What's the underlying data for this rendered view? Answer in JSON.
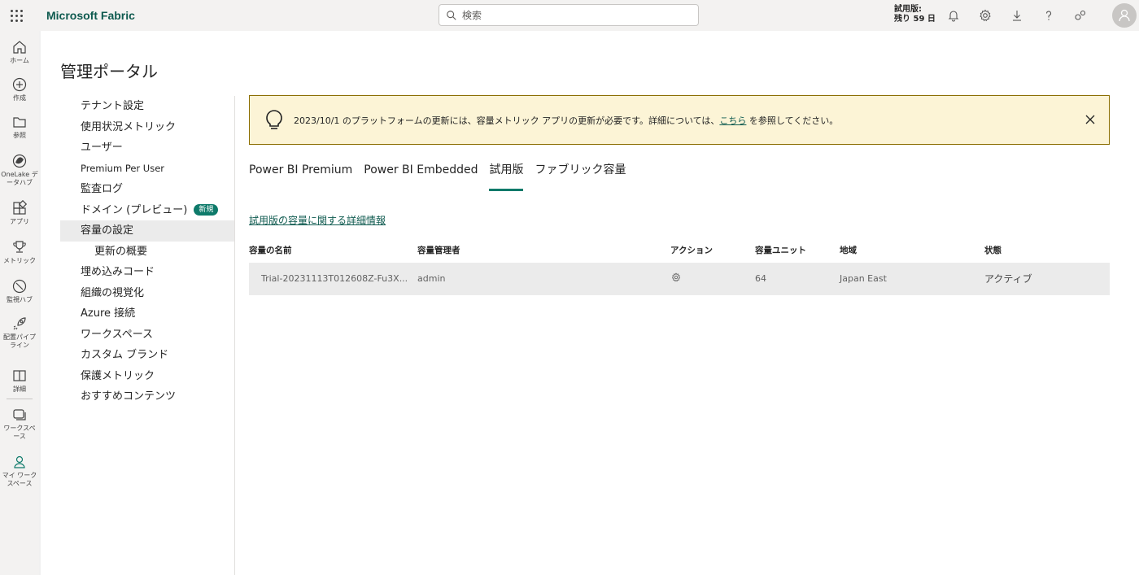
{
  "topbar": {
    "app_name": "Microsoft Fabric",
    "search_placeholder": "検索",
    "trial_line1": "試用版:",
    "trial_line2": "残り 59 日",
    "icons": [
      "bell-icon",
      "gear-icon",
      "download-icon",
      "help-icon",
      "share-icon"
    ]
  },
  "rail": {
    "items": [
      {
        "label": "ホーム",
        "icon": "home-icon"
      },
      {
        "label": "作成",
        "icon": "create-icon"
      },
      {
        "label": "参照",
        "icon": "browse-icon"
      },
      {
        "label": "OneLake デ\nータハブ",
        "icon": "onelake-icon"
      },
      {
        "label": "アプリ",
        "icon": "apps-icon"
      },
      {
        "label": "メトリック",
        "icon": "trophy-icon"
      },
      {
        "label": "監視ハブ",
        "icon": "monitor-icon"
      },
      {
        "label": "配置パイプ\nライン",
        "icon": "rocket-icon"
      },
      {
        "label": "詳細",
        "icon": "book-icon"
      },
      {
        "label": "ワークスペ\nース",
        "icon": "workspaces-icon"
      },
      {
        "label": "マイ ワーク\nスペース",
        "icon": "person-icon"
      }
    ]
  },
  "page": {
    "title": "管理ポータル"
  },
  "nav": {
    "items": [
      {
        "label": "テナント設定"
      },
      {
        "label": "使用状況メトリック"
      },
      {
        "label": "ユーザー"
      },
      {
        "label": "Premium Per User"
      },
      {
        "label": "監査ログ"
      },
      {
        "label": "ドメイン (プレビュー)",
        "badge": "新規"
      },
      {
        "label": "容量の設定"
      },
      {
        "label": "更新の概要"
      },
      {
        "label": "埋め込みコード"
      },
      {
        "label": "組織の視覚化"
      },
      {
        "label": "Azure 接続"
      },
      {
        "label": "ワークスペース"
      },
      {
        "label": "カスタム ブランド"
      },
      {
        "label": "保護メトリック"
      },
      {
        "label": "おすすめコンテンツ"
      }
    ]
  },
  "banner": {
    "text_before": "2023/10/1 のプラットフォームの更新には、容量メトリック アプリの更新が必要です。詳細については、",
    "link": "こちら",
    "text_after": " を参照してください。"
  },
  "tabs": [
    "Power BI Premium",
    "Power BI Embedded",
    "試用版",
    "ファブリック容量"
  ],
  "details_link": "試用版の容量に関する詳細情報",
  "table": {
    "headers": [
      "容量の名前",
      "容量管理者",
      "アクション",
      "容量ユニット",
      "地域",
      "状態"
    ],
    "rows": [
      {
        "name": "Trial-20231113T012608Z-Fu3X...",
        "admin": "admin",
        "action_icon": "gear-icon",
        "units": "64",
        "region": "Japan East",
        "state": "アクティブ"
      }
    ]
  },
  "colors": {
    "brand": "#0e5a4f",
    "accent": "#0e7a6a",
    "banner_bg": "#fcf4d6"
  }
}
